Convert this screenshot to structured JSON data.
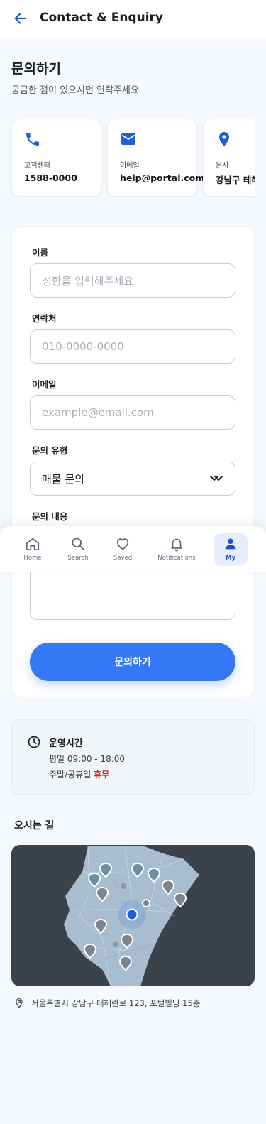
{
  "header": {
    "title": "Contact & Enquiry",
    "back_icon": "arrow-left-icon"
  },
  "intro": {
    "title": "문의하기",
    "subtitle": "궁금한 점이 있으시면 연락주세요"
  },
  "contact_cards": [
    {
      "icon": "phone-icon",
      "label": "고객센터",
      "value": "1588-0000"
    },
    {
      "icon": "mail-icon",
      "label": "이메일",
      "value": "help@portal.com"
    },
    {
      "icon": "location-pin-icon",
      "label": "본사",
      "value": "강남구 테헤란로"
    }
  ],
  "form": {
    "name_label": "이름",
    "name_placeholder": "성함을 입력해주세요",
    "phone_label": "연락처",
    "phone_placeholder": "010-0000-0000",
    "email_label": "이메일",
    "email_placeholder": "example@email.com",
    "type_label": "문의 유형",
    "type_selected": "매물 문의",
    "content_label": "문의 내용",
    "submit_label": "문의하기"
  },
  "bottom_nav": [
    {
      "icon": "home-icon",
      "label": "Home",
      "active": false
    },
    {
      "icon": "search-icon",
      "label": "Search",
      "active": false
    },
    {
      "icon": "heart-icon",
      "label": "Saved",
      "active": false
    },
    {
      "icon": "bell-icon",
      "label": "Notifications",
      "active": false
    },
    {
      "icon": "person-icon",
      "label": "My",
      "active": true
    }
  ],
  "hours": {
    "title": "운영시간",
    "weekday": "평일 09:00 - 18:00",
    "weekend_prefix": "주말/공휴일",
    "weekend_status": "휴무"
  },
  "directions": {
    "title": "오시는 길",
    "address": "서울특별시 강남구 테헤란로 123, 포털빌딩 15층"
  },
  "colors": {
    "primary": "#3478f6",
    "icon_blue": "#1f5fd6",
    "closed_red": "#d62a2a",
    "map_bg": "#3c4249"
  }
}
